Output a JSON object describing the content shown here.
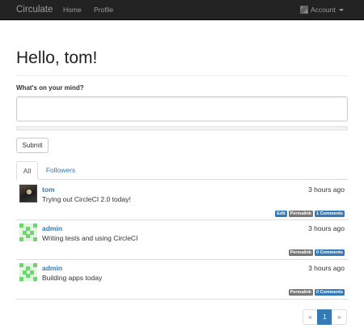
{
  "navbar": {
    "brand": "Circulate",
    "links": [
      "Home",
      "Profile"
    ],
    "account_label": "Account"
  },
  "header": {
    "greeting": "Hello, tom!"
  },
  "composer": {
    "label": "What's on your mind?",
    "value": "",
    "submit_label": "Submit"
  },
  "tabs": [
    {
      "label": "All",
      "active": true
    },
    {
      "label": "Followers",
      "active": false
    }
  ],
  "feed": [
    {
      "author": "tom",
      "time": "3 hours ago",
      "text": "Trying out CircleCI 2.0 today!",
      "avatar": "photo-avatar-icon",
      "edit_label": "Edit",
      "permalink_label": "Permalink",
      "comments_label": "1 Comments"
    },
    {
      "author": "admin",
      "time": "3 hours ago",
      "text": "Writing tests and using CircleCI",
      "avatar": "identicon-avatar-icon",
      "permalink_label": "Permalink",
      "comments_label": "0 Comments"
    },
    {
      "author": "admin",
      "time": "3 hours ago",
      "text": "Building apps today",
      "avatar": "identicon-avatar-icon",
      "permalink_label": "Permalink",
      "comments_label": "0 Comments"
    }
  ],
  "pagination": {
    "prev": "«",
    "current": "1",
    "next": "»"
  },
  "colors": {
    "navbar": "#222222",
    "link": "#337ab7",
    "badge_default": "#777777",
    "identicon": "#6fd56f"
  }
}
